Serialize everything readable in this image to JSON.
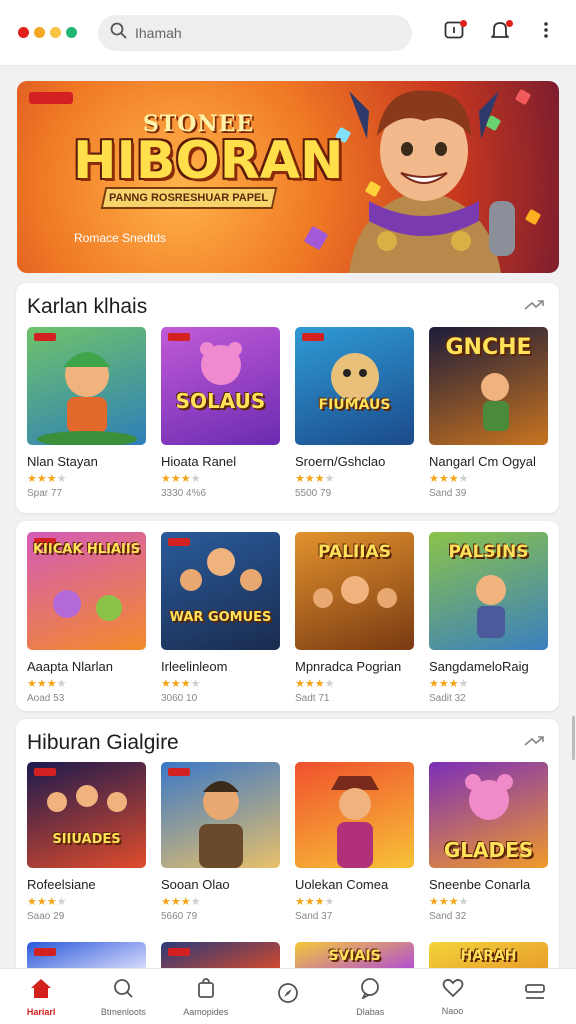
{
  "header": {
    "dot_colors": [
      "#e0201b",
      "#f5a623",
      "#f6c343",
      "#22b573"
    ],
    "search_value": "Ihamah"
  },
  "banner": {
    "overline": "STONEE",
    "title": "HIBORAN",
    "ribbon": "PANNG ROSRESHUAR PAPEL",
    "subtitle": "Romace Snedtds"
  },
  "section1": {
    "title": "Karlan klhais",
    "games": [
      {
        "thumb_text": "",
        "name": "Nlan Stayan",
        "rating": 3,
        "meta": "Spar 77"
      },
      {
        "thumb_text": "SOLAUS",
        "name": "Hioata Ranel",
        "rating": 3,
        "meta": "3330 4%6"
      },
      {
        "thumb_text": "FIUMAUS",
        "name": "Sroern/Gshclao",
        "rating": 3,
        "meta": "5500 79"
      },
      {
        "thumb_text": "GNCHE",
        "name": "Nangarl Cm Ogyal",
        "rating": 3,
        "meta": "Sand 39"
      },
      {
        "thumb_text": "KIICAK HLIAIIS",
        "name": "Aaapta Nlarlan",
        "rating": 3,
        "meta": "Aoad 53"
      },
      {
        "thumb_text": "WAR GOMUES",
        "name": "Irleelinleom",
        "rating": 3,
        "meta": "3060 10"
      },
      {
        "thumb_text": "PALIIAS",
        "name": "Mpnradca Pogrian",
        "rating": 3,
        "meta": "Sadt 71"
      },
      {
        "thumb_text": "PALSINS",
        "name": "SangdameloRaig",
        "rating": 3,
        "meta": "Sadit 32"
      }
    ]
  },
  "section2": {
    "title": "Hiburan Gialgire",
    "games": [
      {
        "thumb_text": "SIIUADES",
        "name": "Rofeelsiane",
        "rating": 3,
        "meta": "Saao 29"
      },
      {
        "thumb_text": "",
        "name": "Sooan Olao",
        "rating": 3,
        "meta": "5660 79"
      },
      {
        "thumb_text": "",
        "name": "Uolekan Comea",
        "rating": 3,
        "meta": "Sand 37"
      },
      {
        "thumb_text": "GLADES",
        "name": "Sneenbe Conarla",
        "rating": 3,
        "meta": "Sand 32"
      }
    ],
    "peek_text": [
      "",
      "",
      "SVIAIS",
      "HARAH"
    ]
  },
  "bottom_nav": [
    {
      "label": "Hariarl",
      "icon": "home-icon",
      "active": true
    },
    {
      "label": "Btmenloots",
      "icon": "search-icon",
      "active": false
    },
    {
      "label": "Aamopides",
      "icon": "bag-icon",
      "active": false
    },
    {
      "label": "",
      "icon": "compass-icon",
      "active": false
    },
    {
      "label": "Dlabas",
      "icon": "chat-icon",
      "active": false
    },
    {
      "label": "Naoo",
      "icon": "heart-icon",
      "active": false
    },
    {
      "label": "",
      "icon": "menu-icon",
      "active": false
    }
  ],
  "colors": {
    "accent": "#d3211c",
    "star": "#f2a516",
    "thumb_gradients": [
      [
        "#6fc36a",
        "#2e7fb9"
      ],
      [
        "#c25bd8",
        "#6a2bb0"
      ],
      [
        "#2f9bd6",
        "#1b4a8a"
      ],
      [
        "#1c1c3a",
        "#c9741f"
      ],
      [
        "#d45bb8",
        "#f28b2a"
      ],
      [
        "#2a5b9b",
        "#1a2c4f"
      ],
      [
        "#e2922e",
        "#7a3a12"
      ],
      [
        "#8bc34a",
        "#3a7fbf"
      ],
      [
        "#1b1a4f",
        "#e04c2b"
      ],
      [
        "#3a78c8",
        "#e8c06a"
      ],
      [
        "#f0512d",
        "#f7c238"
      ],
      [
        "#7b2fb8",
        "#f09a2a"
      ]
    ]
  }
}
